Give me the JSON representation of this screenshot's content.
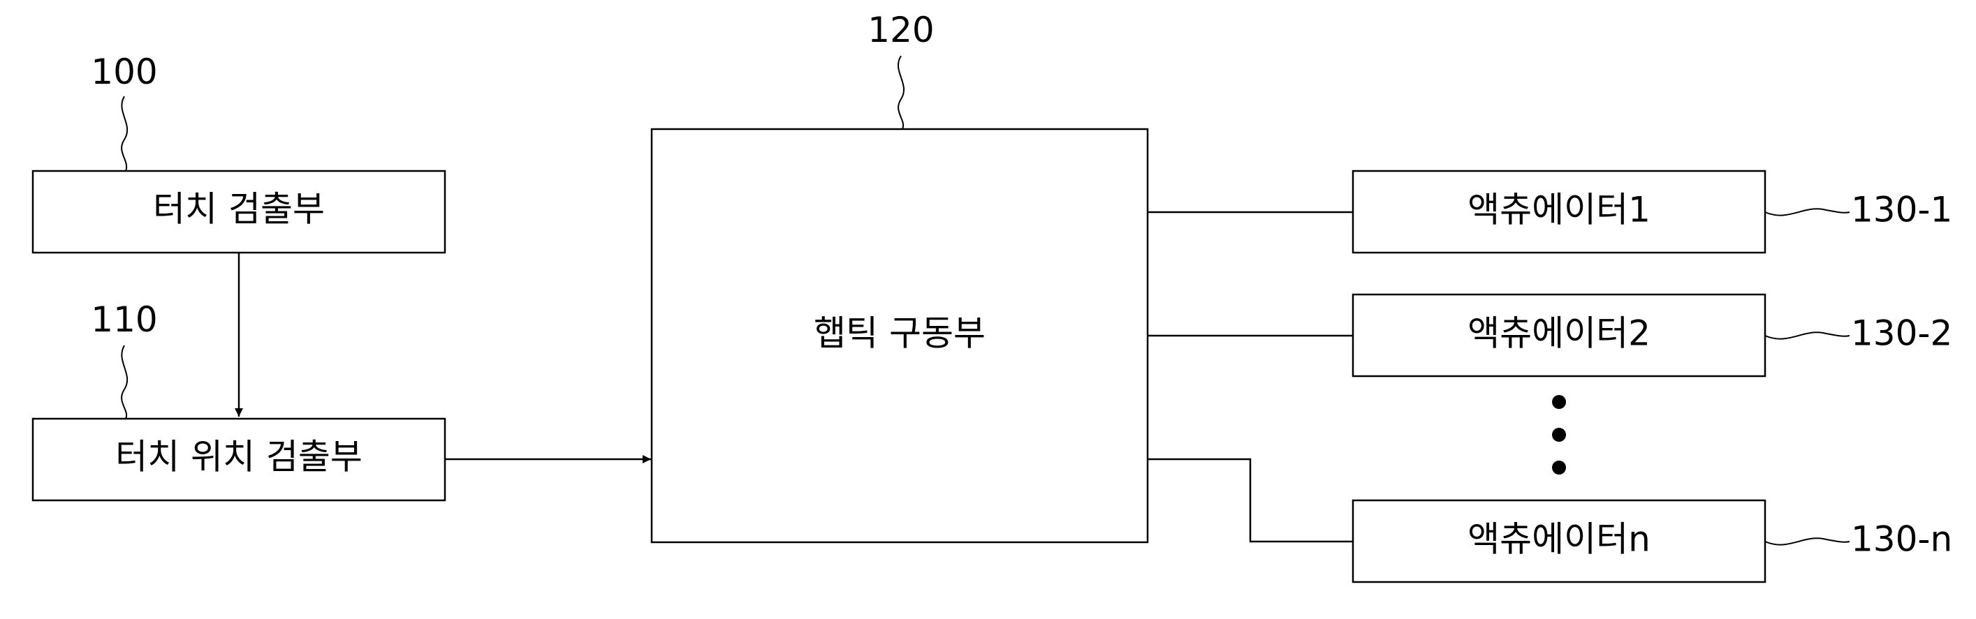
{
  "blocks": {
    "touch_detector": {
      "label": "터치 검출부",
      "ref": "100"
    },
    "touch_position_detector": {
      "label": "터치 위치 검출부",
      "ref": "110"
    },
    "haptic_driver": {
      "label": "햅틱 구동부",
      "ref": "120"
    },
    "actuators": [
      {
        "label": "액츄에이터1",
        "ref": "130-1"
      },
      {
        "label": "액츄에이터2",
        "ref": "130-2"
      },
      {
        "label": "액츄에이터n",
        "ref": "130-n"
      }
    ]
  }
}
